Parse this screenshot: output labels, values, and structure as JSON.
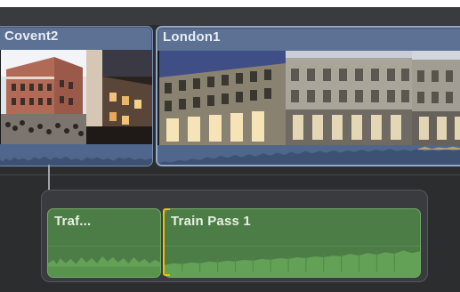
{
  "timeline": {
    "primary_clips": [
      {
        "title": "Covent2",
        "kind": "video"
      },
      {
        "title": "London1",
        "kind": "video"
      }
    ],
    "connected_storyline": {
      "clips": [
        {
          "title": "Traf...",
          "kind": "audio"
        },
        {
          "title": "Train Pass 1",
          "kind": "audio"
        }
      ]
    }
  },
  "colors": {
    "timeline_background": "#2c2d2f",
    "video_clip": "#5c7193",
    "audio_clip": "#4d7d46",
    "edit_point": "#f0c000"
  }
}
